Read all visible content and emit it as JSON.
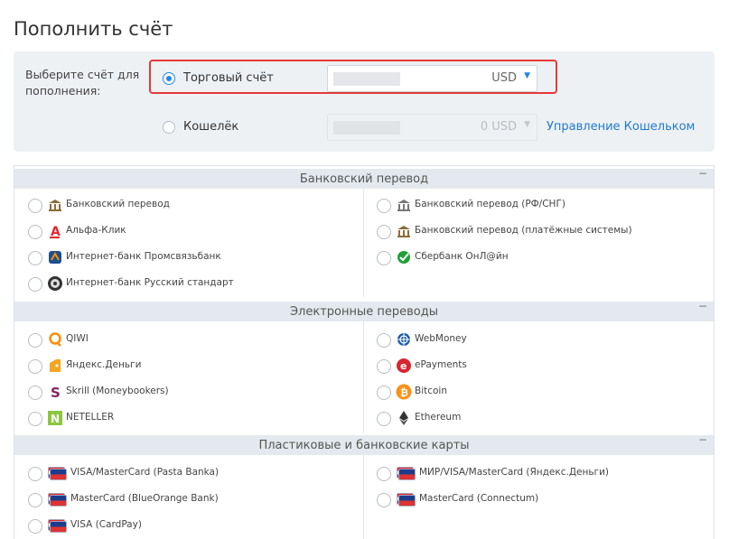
{
  "page": {
    "title": "Пополнить счёт"
  },
  "account": {
    "choose_label": "Выберите счёт для пополнения:",
    "trading": {
      "label": "Торговый счёт",
      "currency": "USD"
    },
    "wallet": {
      "label": "Кошелёк",
      "amount_currency": "0 USD",
      "manage_link": "Управление Кошельком"
    }
  },
  "groups": [
    {
      "title": "Банковский перевод",
      "collapse": "−",
      "left": [
        {
          "label": "Банковский перевод",
          "icon": "bank-icon"
        },
        {
          "label": "Альфа-Клик",
          "icon": "alfa-icon"
        },
        {
          "label": "Интернет-банк Промсвязьбанк",
          "icon": "psb-icon"
        },
        {
          "label": "Интернет-банк Русский стандарт",
          "icon": "russian-standard-icon"
        }
      ],
      "right": [
        {
          "label": "Банковский перевод (РФ/СНГ)",
          "icon": "bank-icon"
        },
        {
          "label": "Банковский перевод (платёжные системы)",
          "icon": "bank-icon"
        },
        {
          "label": "Сбербанк ОнЛ@йн",
          "icon": "sberbank-icon"
        }
      ]
    },
    {
      "title": "Электронные переводы",
      "collapse": "−",
      "left": [
        {
          "label": "QIWI",
          "icon": "qiwi-icon"
        },
        {
          "label": "Яндекс.Деньги",
          "icon": "yandex-money-icon"
        },
        {
          "label": "Skrill (Moneybookers)",
          "icon": "skrill-icon"
        },
        {
          "label": "NETELLER",
          "icon": "neteller-icon"
        }
      ],
      "right": [
        {
          "label": "WebMoney",
          "icon": "webmoney-icon"
        },
        {
          "label": "ePayments",
          "icon": "epayments-icon"
        },
        {
          "label": "Bitcoin",
          "icon": "bitcoin-icon"
        },
        {
          "label": "Ethereum",
          "icon": "ethereum-icon"
        }
      ]
    },
    {
      "title": "Пластиковые и банковские карты",
      "collapse": "−",
      "left": [
        {
          "label": "VISA/MasterCard (Pasta Banka)",
          "icon": "card-icon"
        },
        {
          "label": "MasterCard (BlueOrange Bank)",
          "icon": "card-icon"
        },
        {
          "label": "VISA (CardPay)",
          "icon": "card-icon"
        }
      ],
      "right": [
        {
          "label": "МИР/VISA/MasterCard (Яндекс.Деньги)",
          "icon": "card-icon"
        },
        {
          "label": "MasterCard (Connectum)",
          "icon": "card-icon"
        }
      ]
    }
  ]
}
